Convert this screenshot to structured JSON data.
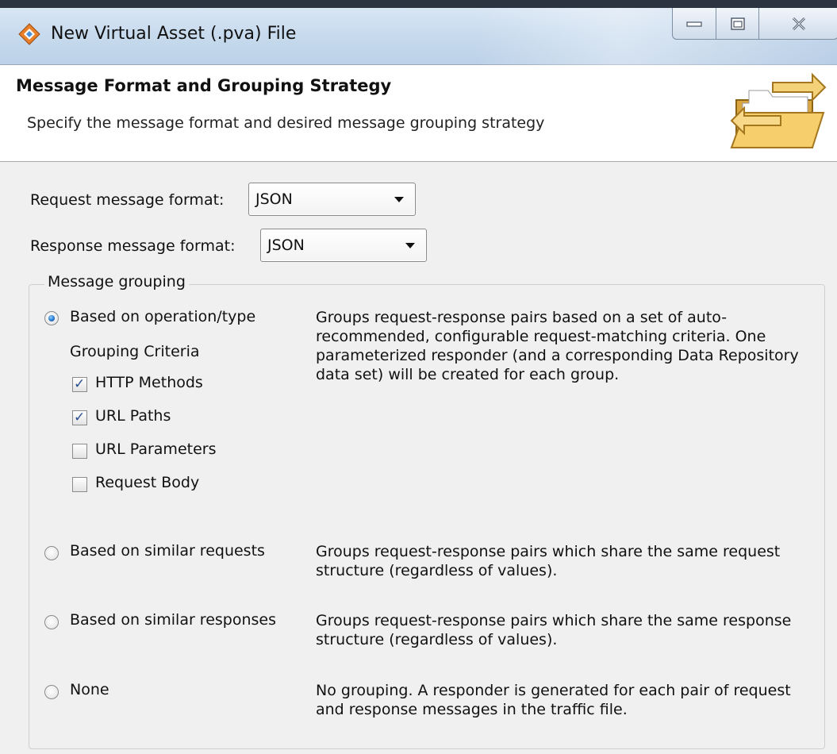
{
  "window": {
    "title": "New Virtual Asset (.pva) File",
    "buttons": [
      "minimize-icon",
      "maximize-icon",
      "close-icon"
    ]
  },
  "header": {
    "title": "Message Format and Grouping Strategy",
    "subtitle": "Specify the message format and desired message grouping strategy",
    "icon": "folder-transfer-icon"
  },
  "request_format": {
    "label": "Request message format:",
    "value": "JSON"
  },
  "response_format": {
    "label": "Response message format:",
    "value": "JSON"
  },
  "grouping": {
    "legend": "Message grouping",
    "criteria_label": "Grouping Criteria",
    "options": [
      {
        "label": "Based on operation/type",
        "selected": true,
        "description": "Groups request-response pairs based on a set of auto-recommended, configurable request-matching criteria. One parameterized responder (and a corresponding Data Repository data set) will be created for each group."
      },
      {
        "label": "Based on similar requests",
        "selected": false,
        "description": "Groups request-response pairs which share the same request structure (regardless of values)."
      },
      {
        "label": "Based on similar responses",
        "selected": false,
        "description": "Groups request-response pairs which share the same response structure (regardless of values)."
      },
      {
        "label": "None",
        "selected": false,
        "description": "No grouping. A responder is generated for each pair of request and response messages in the traffic file."
      }
    ],
    "criteria": [
      {
        "label": "HTTP Methods",
        "checked": true
      },
      {
        "label": "URL Paths",
        "checked": true
      },
      {
        "label": "URL Parameters",
        "checked": false
      },
      {
        "label": "Request Body",
        "checked": false
      }
    ]
  },
  "colors": {
    "radio_selected": "#1f6fc8",
    "check_mark": "#2a4f90",
    "titlebar": "#c8dbee"
  }
}
